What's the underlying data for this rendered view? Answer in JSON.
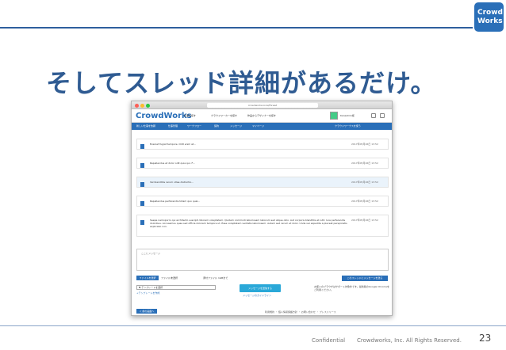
{
  "logo": {
    "line1": "Crowd",
    "line2": "Works"
  },
  "slide": {
    "title": "そしてスレッド詳細があるだけ。",
    "confidential": "Confidential",
    "copyright": "Crowdworks, Inc. All Rights Reserved.",
    "page_number": "23"
  },
  "browser": {
    "url": "crowdworks.local/thread"
  },
  "app": {
    "logo": "CrowdWorks",
    "header_links": [
      "仕事を探す",
      "クラウドワーカーを探す",
      "作品からデザイナーを探す"
    ],
    "user_name": "Kaneshiro様",
    "nav": [
      "新しい仕事を依頼",
      "仕事管理",
      "ワークフロー",
      "契約",
      "メッセージ",
      "マイページ"
    ],
    "nav_right": "クラウドワークスを使う"
  },
  "messages": [
    {
      "text": "Eveniet fugiat tempore. Odit enim at...",
      "time": "2017年05月26日 13:52",
      "highlight": false
    },
    {
      "text": "Repellendus et dolor odit quia qui. F...",
      "time": "2017年05月26日 13:52",
      "highlight": false
    },
    {
      "text": "Vel blanditiis rerum vitae distinctio...",
      "time": "2017年05月26日 13:52",
      "highlight": true
    },
    {
      "text": "Repellendus perferendis totam quo qual...",
      "time": "2017年05月26日 13:52",
      "highlight": false
    },
    {
      "text": "Saepe nemoporro qui architecto suscipit dolorem voluptatem. Quidem commodi laboriosam laborum sed atque odio. Aut corporis blanditiis et odit. Iure perferendis doloribus. Accusamus quae sed officia dolorem tempore ut. Esse voluptatem veritatis laboriosam. Autem sed rerum et dolor. Unde vel expedita a placeat perspiciatis explicabo non.",
      "time": "2017年05月26日 13:52",
      "highlight": false
    }
  ],
  "compose": {
    "placeholder": "ここにメッセージ",
    "file_button": "ファイルを選択",
    "file_none": "ファイル未選択",
    "file_limit": "添付ファイル 1GBまで",
    "send_top": "このスレッドにメッセージを送る",
    "template_select": "▼ テンプレートを選択",
    "template_create": "+テンプレートを作成",
    "send_button": "メッセージを送信する",
    "guide_link": "メッセージのガイドライン",
    "notice": "お使いのブラウザはサポート対象外です。最新版のGoogle Chromeをご利用ください。"
  },
  "footer": {
    "back_button": "＜ 前の画面へ",
    "links": "利用規約 ・ 個人情報保護方針 ・ お問い合わせ ・ プレスリリース"
  },
  "colors": {
    "brand": "#2a6fb8",
    "title": "#2f5b92",
    "send": "#2aa8d8"
  }
}
